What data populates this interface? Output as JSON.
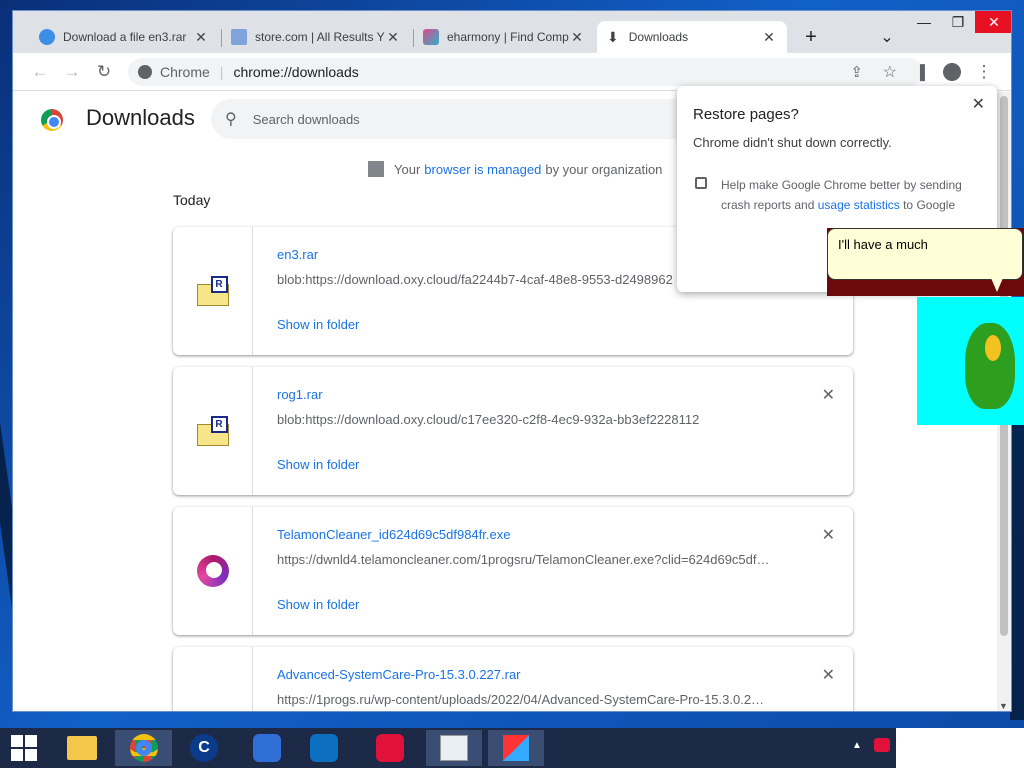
{
  "tabs": [
    {
      "label": "Download a file en3.rar",
      "close": "✕"
    },
    {
      "label": "store.com | All Results Y",
      "close": "✕"
    },
    {
      "label": "eharmony | Find Compa",
      "close": "✕"
    },
    {
      "label": "Downloads",
      "close": "✕"
    }
  ],
  "tabbar": {
    "new_tab": "+",
    "tab_search": "⌄"
  },
  "window": {
    "minimize": "—",
    "maximize": "❐",
    "close": "✕"
  },
  "toolbar": {
    "site_label": "Chrome",
    "url": "chrome://downloads"
  },
  "page": {
    "title": "Downloads",
    "search_placeholder": "Search downloads",
    "managed_prefix": "Your ",
    "managed_link": "browser is managed",
    "managed_suffix": " by your organization",
    "section": "Today"
  },
  "downloads": [
    {
      "name": "en3.rar",
      "url": "blob:https://download.oxy.cloud/fa2244b7-4caf-48e8-9553-d2498962",
      "action": "Show in folder",
      "icon": "rar-archive-icon"
    },
    {
      "name": "rog1.rar",
      "url": "blob:https://download.oxy.cloud/c17ee320-c2f8-4ec9-932a-bb3ef2228112",
      "action": "Show in folder",
      "icon": "rar-archive-icon"
    },
    {
      "name": "TelamonCleaner_id624d69c5df984fr.exe",
      "url": "https://dwnld4.telamoncleaner.com/1progsru/TelamonCleaner.exe?clid=624d69c5df…",
      "action": "Show in folder",
      "icon": "telamon-icon"
    },
    {
      "name": "Advanced-SystemCare-Pro-15.3.0.227.rar",
      "url": "https://1progs.ru/wp-content/uploads/2022/04/Advanced-SystemCare-Pro-15.3.0.2…",
      "action": "",
      "icon": "rar-archive-icon"
    }
  ],
  "restore_popup": {
    "title": "Restore pages?",
    "body": "Chrome didn't shut down correctly.",
    "checkbox_text_1": "Help make Google Chrome better by sending",
    "checkbox_text_2": "crash reports and ",
    "checkbox_link": "usage statistics",
    "checkbox_text_3": " to Google"
  },
  "assistant": {
    "speech": "I'll have a much"
  },
  "colors": {
    "link": "#1a73e8",
    "tabbar": "#dee1e6",
    "taskbar": "#1c2a47"
  }
}
